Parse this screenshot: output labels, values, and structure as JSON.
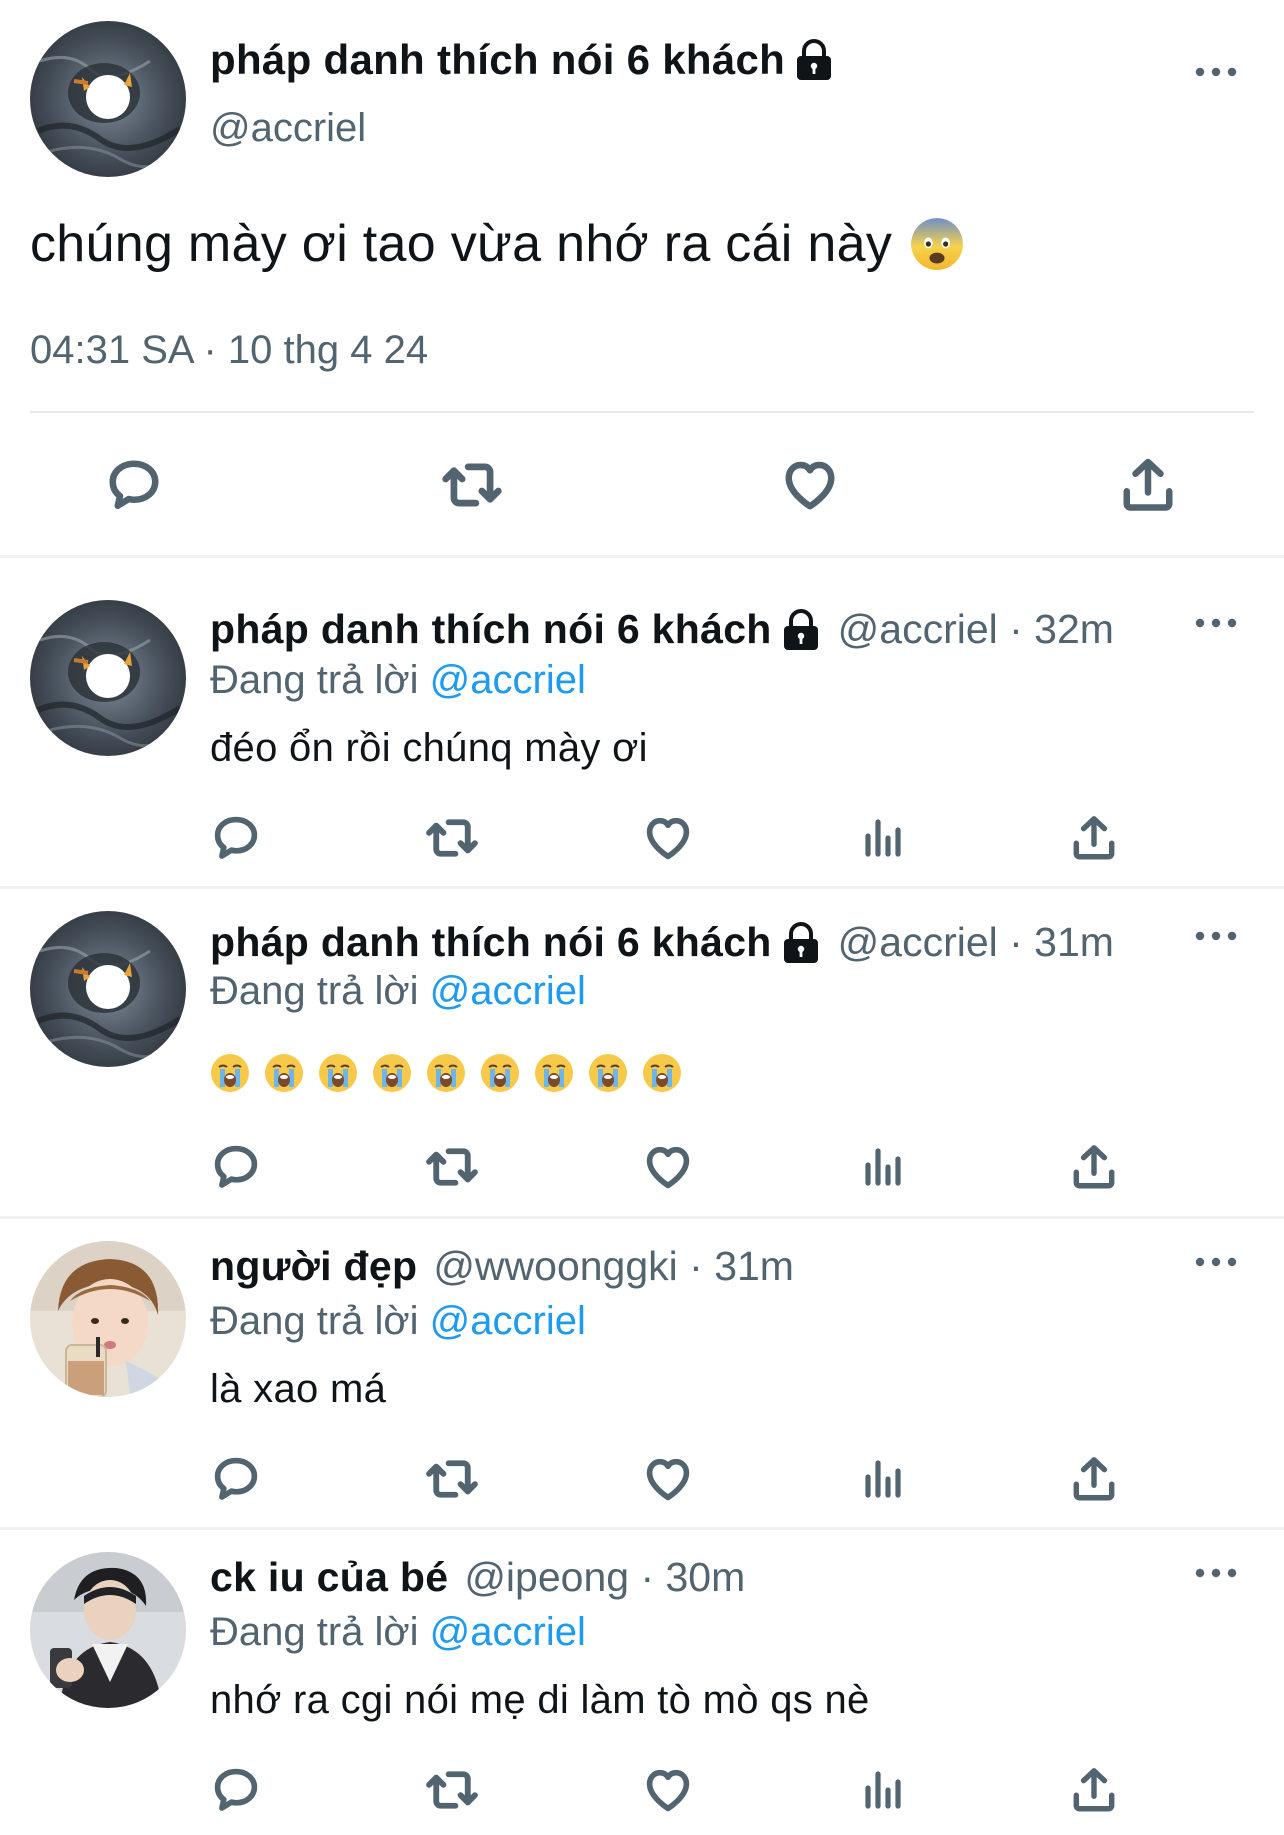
{
  "main_tweet": {
    "display_name": "pháp danh thích nói 6 khách",
    "handle": "@accriel",
    "text": "chúng mày ơi tao vừa nhớ ra cái này",
    "text_emoji": "fearful-face",
    "timestamp": "04:31 SA · 10 thg 4 24",
    "actions": [
      "reply-icon",
      "retweet-icon",
      "like-icon",
      "share-icon"
    ]
  },
  "replies": [
    {
      "display_name": "pháp danh thích nói 6 khách",
      "handle": "@accriel",
      "time": "32m",
      "meta": "@accriel · 32m",
      "replying_prefix": "Đang trả lời",
      "replying_to": "@accriel",
      "text": "đéo ổn rồi chúnq mày ơi",
      "locked": true
    },
    {
      "display_name": "pháp danh thích nói 6 khách",
      "handle": "@accriel",
      "time": "31m",
      "meta": "@accriel · 31m",
      "replying_prefix": "Đang trả lời",
      "replying_to": "@accriel",
      "text": "",
      "emoji_sequence": [
        "loudly-crying-face",
        "loudly-crying-face",
        "loudly-crying-face",
        "loudly-crying-face",
        "loudly-crying-face",
        "loudly-crying-face",
        "loudly-crying-face",
        "loudly-crying-face",
        "loudly-crying-face"
      ],
      "locked": true
    },
    {
      "display_name": "người đẹp",
      "handle": "@wwoonggki",
      "time": "31m",
      "meta": "@wwoonggki · 31m",
      "replying_prefix": "Đang trả lời",
      "replying_to": "@accriel",
      "text": "là xao má",
      "locked": false
    },
    {
      "display_name": "ck iu của bé",
      "handle": "@ipeong",
      "time": "30m",
      "meta": "@ipeong · 30m",
      "replying_prefix": "Đang trả lời",
      "replying_to": "@accriel",
      "text": "nhớ ra cgi nói mẹ di làm tò mò qs nè",
      "locked": false
    }
  ],
  "reply_actions": [
    "reply-icon",
    "retweet-icon",
    "like-icon",
    "views-icon",
    "share-icon"
  ],
  "colors": {
    "text": "#0f1419",
    "secondary": "#536471",
    "mention": "#1d9bf0",
    "divider": "#eff1f3"
  }
}
